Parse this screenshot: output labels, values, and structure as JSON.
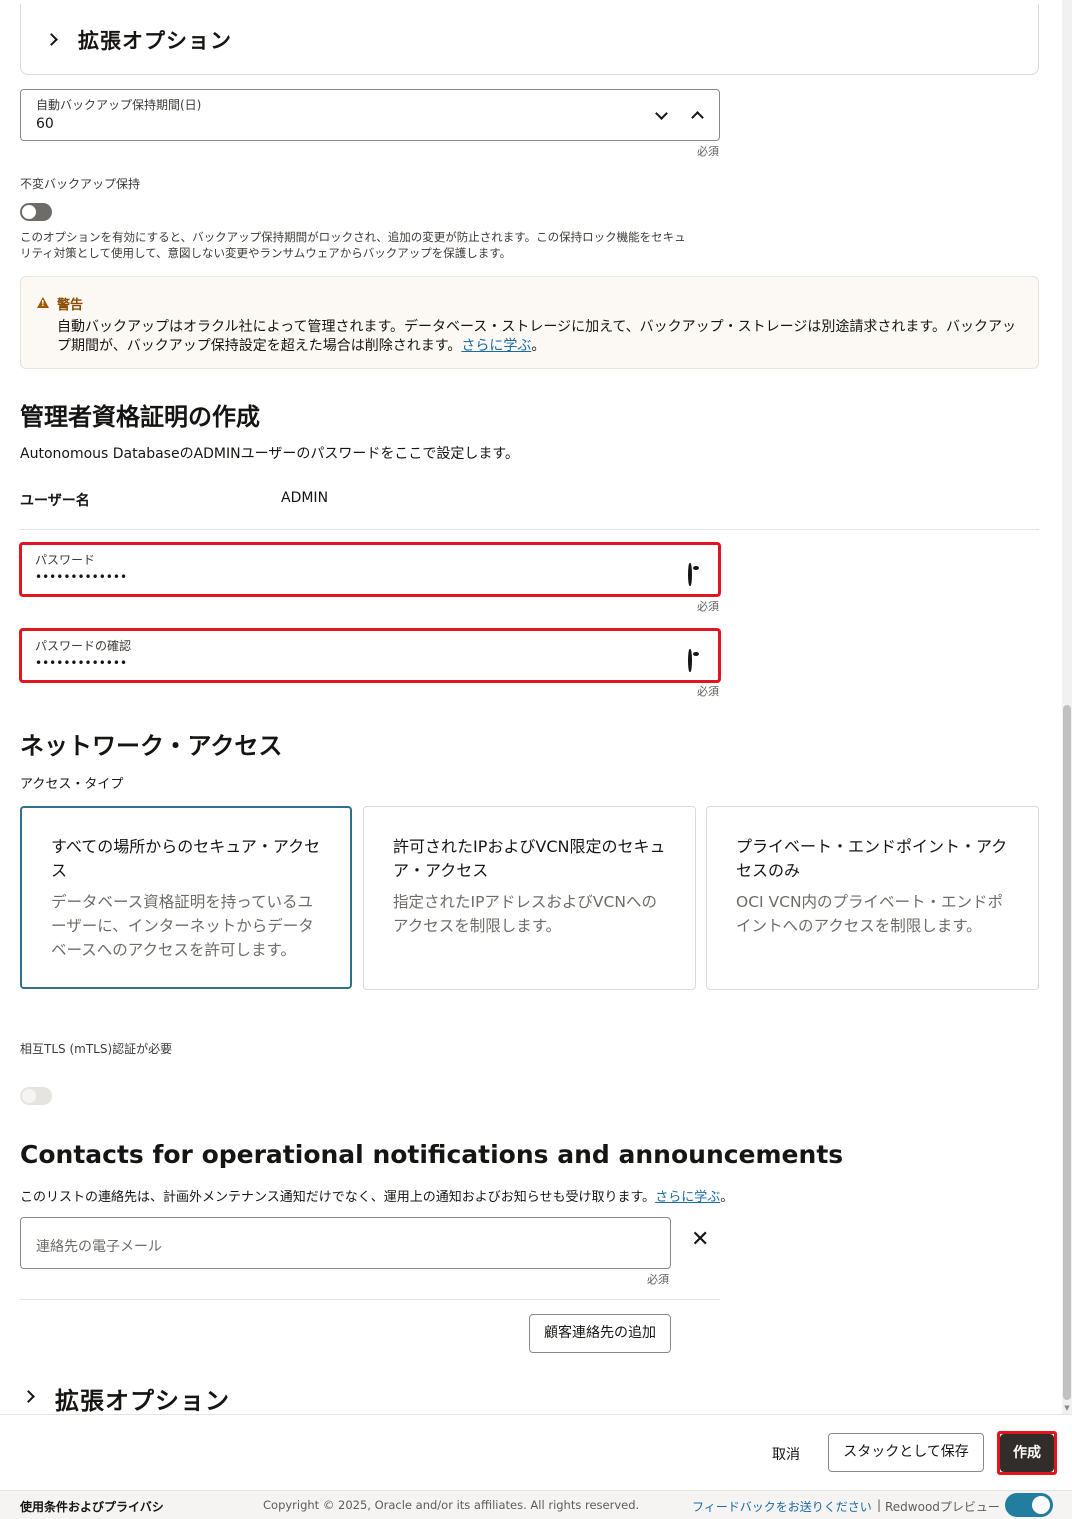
{
  "extended_options_top": {
    "title": "拡張オプション"
  },
  "backup_retention": {
    "label": "自動バックアップ保持期間(日)",
    "value": "60",
    "required": "必須"
  },
  "immutable_backup": {
    "label": "不変バックアップ保持",
    "enabled": false,
    "help_line1": "このオプションを有効にすると、バックアップ保持期間がロックされ、追加の変更が防止されます。この保持ロック機能をセキュ",
    "help_line2": "リティ対策として使用して、意図しない変更やランサムウェアからバックアップを保護します。"
  },
  "warning": {
    "title": "警告",
    "line1": "自動バックアップはオラクル社によって管理されます。データベース・ストレージに加えて、バックアップ・ストレージは別途請求されます。バックアッ",
    "line2_prefix": "プ期間が、バックアップ保持設定を超えた場合は削除されます。",
    "link": "さらに学ぶ",
    "line2_suffix": "。",
    "color": "#a15900"
  },
  "admin_credentials": {
    "title": "管理者資格証明の作成",
    "description": "Autonomous DatabaseのADMINユーザーのパスワードをここで設定します。",
    "username_label": "ユーザー名",
    "username_value": "ADMIN",
    "password": {
      "label": "パスワード",
      "value": "•••••••••••••",
      "required": "必須"
    },
    "password_confirm": {
      "label": "パスワードの確認",
      "value": "•••••••••••••",
      "required": "必須"
    }
  },
  "network_access": {
    "title": "ネットワーク・アクセス",
    "access_type_label": "アクセス・タイプ",
    "cards": [
      {
        "title_line1": "すべての場所からのセキュア・アクセ",
        "title_line2": "ス",
        "desc_line1": "データベース資格証明を持っているユ",
        "desc_line2": "ーザーに、インターネットからデータ",
        "desc_line3": "ベースへのアクセスを許可します。",
        "selected": true
      },
      {
        "title_line1": "許可されたIPおよびVCN限定のセキュ",
        "title_line2": "ア・アクセス",
        "desc_line1": "指定されたIPアドレスおよびVCNへの",
        "desc_line2": "アクセスを制限します。",
        "selected": false
      },
      {
        "title_line1": "プライベート・エンドポイント・アク",
        "title_line2": "セスのみ",
        "desc_line1": "OCI VCN内のプライベート・エンドポ",
        "desc_line2": "イントへのアクセスを制限します。",
        "selected": false
      }
    ],
    "mtls_label": "相互TLS (mTLS)認証が必要",
    "mtls_enabled": false
  },
  "contacts": {
    "title": "Contacts for operational notifications and announcements",
    "description_prefix": "このリストの連絡先は、計画外メンテナンス通知だけでなく、運用上の通知およびお知らせも受け取ります。",
    "link": "さらに学ぶ",
    "description_suffix": "。",
    "email_placeholder": "連絡先の電子メール",
    "required": "必須",
    "add_button": "顧客連絡先の追加"
  },
  "extended_options_bottom": {
    "title": "拡張オプション"
  },
  "footer": {
    "cancel": "取消",
    "save_stack": "スタックとして保存",
    "create": "作成"
  },
  "legal": {
    "terms": "使用条件およびプライバシ",
    "copyright": "Copyright © 2025, Oracle and/or its affiliates. All rights reserved.",
    "feedback": "フィードバックをお送りください",
    "separator": "|",
    "redwood": "Redwoodプレビュー",
    "redwood_enabled": true
  },
  "colors": {
    "highlight": "#e0151f",
    "link": "#1a6aa3",
    "selected_card": "#31708c",
    "primary_button": "#312d2a",
    "toggle_on": "#227e9e"
  }
}
